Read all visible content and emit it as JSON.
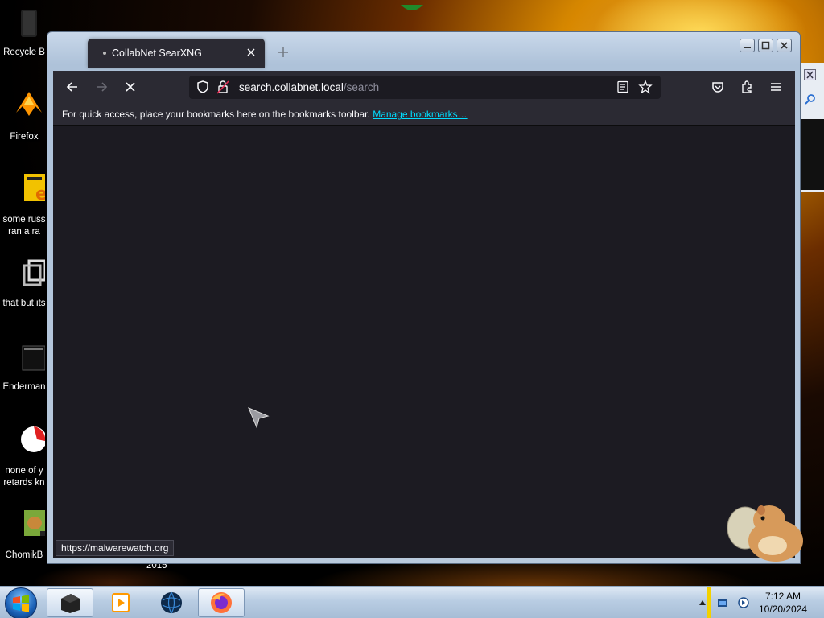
{
  "desktop": {
    "icons": [
      {
        "label": "Recycle B"
      },
      {
        "label": "Firefox"
      },
      {
        "label": "some russ\nran a ra"
      },
      {
        "label": "that but its"
      },
      {
        "label": "Enderman"
      },
      {
        "label": "none of y\nretards kn"
      },
      {
        "label": "ChomikB"
      }
    ],
    "year_label": "2015"
  },
  "browser": {
    "tab": {
      "title": "CollabNet SearXNG"
    },
    "url": {
      "host": "search.collabnet.local",
      "path": "/search"
    },
    "bookmarks_bar": {
      "message": "For quick access, place your bookmarks here on the bookmarks toolbar.",
      "link": "Manage bookmarks…"
    },
    "status_url": "https://malwarewatch.org"
  },
  "taskbar": {
    "time": "7:12 AM",
    "date": "10/20/2024"
  },
  "colors": {
    "browser_bg": "#1c1b22",
    "toolbar_bg": "#2b2a33",
    "link": "#00ddff"
  }
}
